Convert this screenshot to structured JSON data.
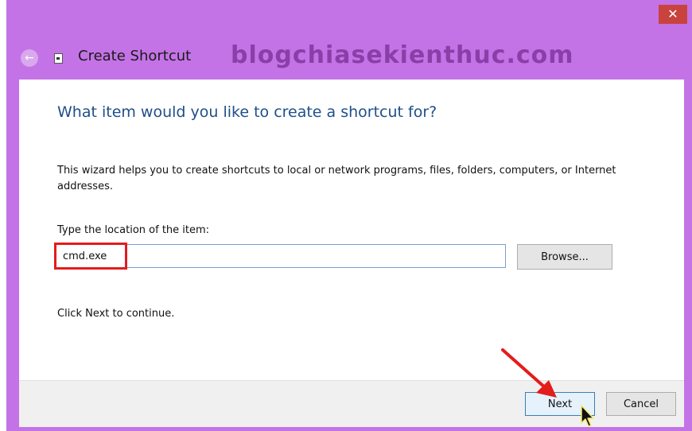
{
  "window": {
    "title": "Create Shortcut",
    "close_symbol": "✕",
    "back_symbol": "←",
    "watermark": "blogchiasekienthuc.com"
  },
  "wizard": {
    "heading": "What item would you like to create a shortcut for?",
    "description": "This wizard helps you to create shortcuts to local or network programs, files, folders, computers, or Internet addresses.",
    "location_label": "Type the location of the item:",
    "location_value": "cmd.exe",
    "browse_label": "Browse...",
    "continue_text": "Click Next to continue."
  },
  "footer": {
    "next_label": "Next",
    "cancel_label": "Cancel"
  },
  "colors": {
    "frame": "#c473e6",
    "heading": "#1e4f8a",
    "highlight": "#e31c1c",
    "arrow": "#e31c1c"
  },
  "icons": [
    "back-arrow-icon",
    "shortcut-icon",
    "close-icon",
    "mouse-cursor-icon"
  ]
}
